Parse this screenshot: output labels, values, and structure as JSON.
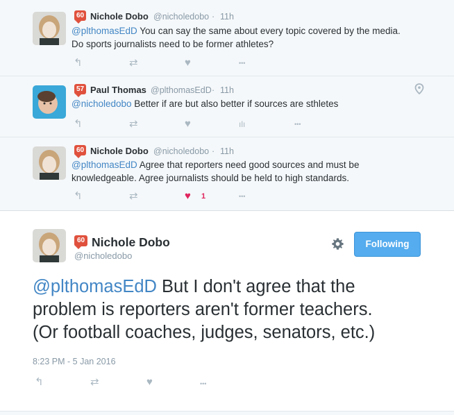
{
  "tweets": [
    {
      "score": "60",
      "name": "Nichole Dobo",
      "handle": "@nicholedobo",
      "dot": "·",
      "time": "11h",
      "mention": "@plthomasEdD",
      "line1_rest": " You can say the same about every topic covered by the media.",
      "line2": "Do sports journalists need to be former athletes?",
      "actions": {
        "reply": "↰",
        "retweet": "⇄",
        "like": "♥",
        "more": "•••"
      }
    },
    {
      "score": "57",
      "name": "Paul Thomas",
      "handle": "@plthomasEdD",
      "dot": "·",
      "time": "11h",
      "mention": "@nicholedobo",
      "line1_rest": " Better if are but also better if sources are sthletes",
      "actions": {
        "reply": "↰",
        "retweet": "⇄",
        "like": "♥",
        "analytics": "ılı",
        "more": "•••"
      }
    },
    {
      "score": "60",
      "name": "Nichole Dobo",
      "handle": "@nicholedobo",
      "dot": "·",
      "time": "11h",
      "mention": "@plthomasEdD",
      "line1_rest": " Agree that reporters need good sources and must be",
      "line2": "knowledgeable. Agree journalists should be held to high standards.",
      "like_count": "1",
      "actions": {
        "reply": "↰",
        "retweet": "⇄",
        "like": "♥",
        "more": "•••"
      }
    }
  ],
  "detail": {
    "score": "60",
    "name": "Nichole Dobo",
    "handle": "@nicholedobo",
    "follow_label": "Following",
    "mention": "@plthomasEdD",
    "line1_rest": " But I don't agree that the",
    "line2": "problem is reporters aren't former teachers.",
    "line3": "(Or football coaches, judges, senators, etc.)",
    "timestamp": "8:23 PM - 5 Jan 2016",
    "actions": {
      "reply": "↰",
      "retweet": "⇄",
      "like": "♥",
      "more": "•••"
    }
  },
  "colors": {
    "accent": "#55acee",
    "mention": "#4286c5",
    "badge": "#e0513d",
    "liked": "#e0245e",
    "muted": "#8899a6"
  }
}
